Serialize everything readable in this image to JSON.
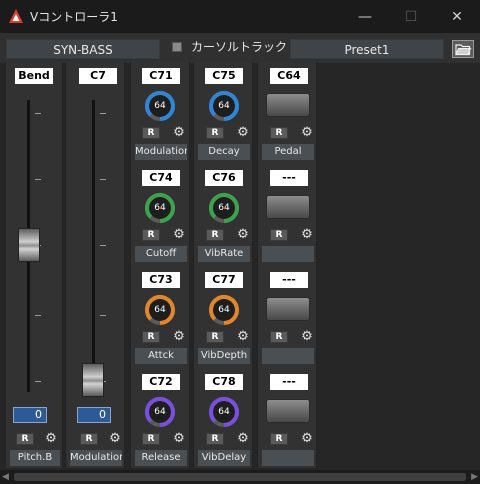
{
  "window": {
    "title": "Vコントローラ1",
    "minimize_glyph": "—",
    "maximize_glyph": "☐",
    "close_glyph": "✕"
  },
  "topbar": {
    "instrument": "SYN-BASS",
    "cursor_track_label": "カーソルトラック",
    "preset": "Preset1",
    "folder_icon": "folder-open-icon"
  },
  "sliders": [
    {
      "header": "Bend",
      "value": "0",
      "r_label": "R",
      "name": "Pitch.B",
      "position": 0.57
    },
    {
      "header": "C7",
      "value": "0",
      "r_label": "R",
      "name": "Modulation",
      "position": 0.0
    }
  ],
  "knob_columns": [
    [
      {
        "cc": "C71",
        "value": "64",
        "r_label": "R",
        "name": "Modulation",
        "color": "#2f86d6"
      },
      {
        "cc": "C74",
        "value": "64",
        "r_label": "R",
        "name": "Cutoff",
        "color": "#3aa34b"
      },
      {
        "cc": "C73",
        "value": "64",
        "r_label": "R",
        "name": "Attck",
        "color": "#e0862d"
      },
      {
        "cc": "C72",
        "value": "64",
        "r_label": "R",
        "name": "Release",
        "color": "#7a4fe0"
      }
    ],
    [
      {
        "cc": "C75",
        "value": "64",
        "r_label": "R",
        "name": "Decay",
        "color": "#2f86d6"
      },
      {
        "cc": "C76",
        "value": "64",
        "r_label": "R",
        "name": "VibRate",
        "color": "#3aa34b"
      },
      {
        "cc": "C77",
        "value": "64",
        "r_label": "R",
        "name": "VibDepth",
        "color": "#e0862d"
      },
      {
        "cc": "C78",
        "value": "64",
        "r_label": "R",
        "name": "VibDelay",
        "color": "#7a4fe0"
      }
    ]
  ],
  "pad_column": [
    {
      "cc": "C64",
      "r_label": "R",
      "name": "Pedal"
    },
    {
      "cc": "---",
      "r_label": "R",
      "name": ""
    },
    {
      "cc": "---",
      "r_label": "R",
      "name": ""
    },
    {
      "cc": "---",
      "r_label": "R",
      "name": ""
    }
  ],
  "icons": {
    "gear": "⚙",
    "logo": "app-logo-icon"
  }
}
